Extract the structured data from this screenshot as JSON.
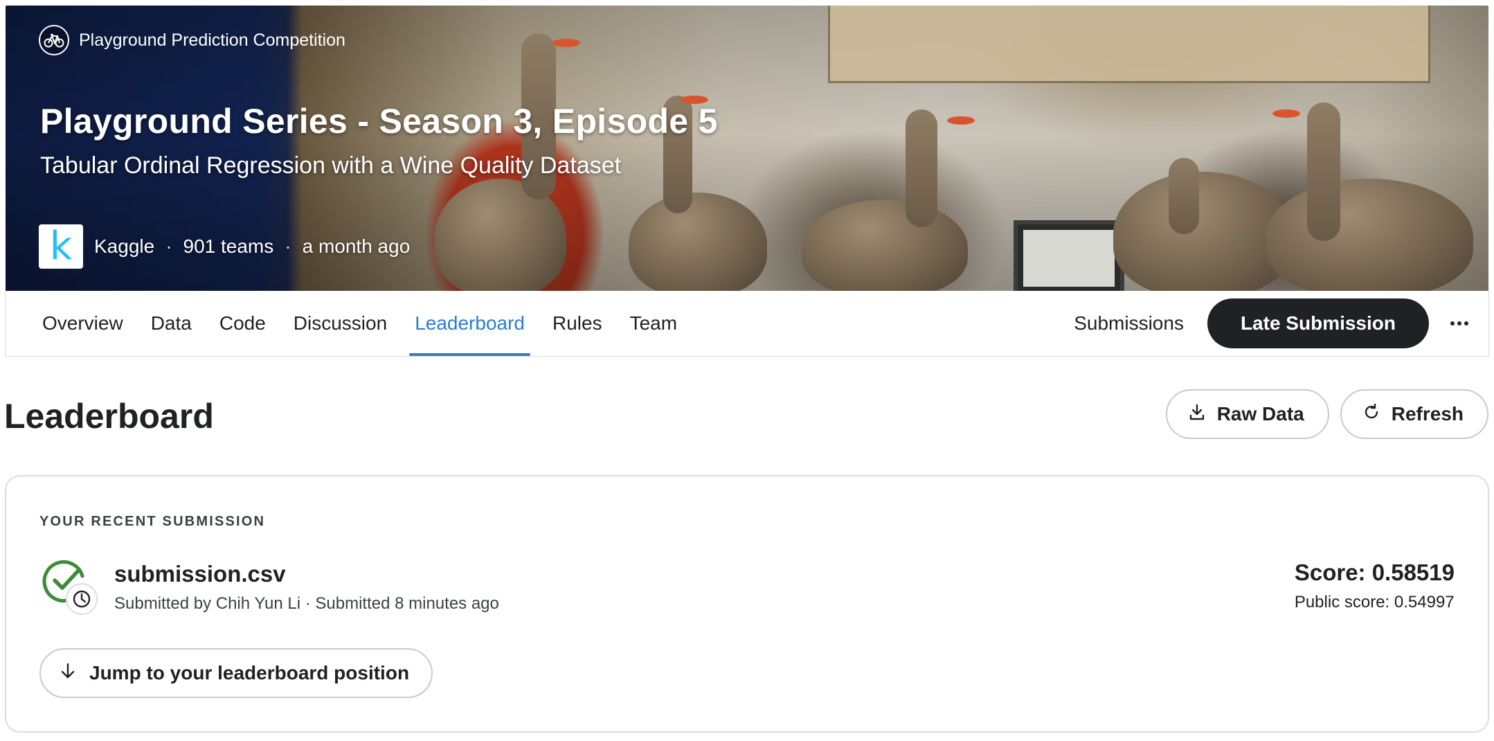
{
  "hero": {
    "competition_type": "Playground Prediction Competition",
    "title": "Playground Series - Season 3, Episode 5",
    "subtitle": "Tabular Ordinal Regression with a Wine Quality Dataset",
    "host_logo_letter": "k",
    "host": "Kaggle",
    "separator": "·",
    "teams": "901 teams",
    "time_ago": "a month ago",
    "competition_icon": "bicycle-icon"
  },
  "tabs": {
    "items": [
      {
        "label": "Overview",
        "active": false
      },
      {
        "label": "Data",
        "active": false
      },
      {
        "label": "Code",
        "active": false
      },
      {
        "label": "Discussion",
        "active": false
      },
      {
        "label": "Leaderboard",
        "active": true
      },
      {
        "label": "Rules",
        "active": false
      },
      {
        "label": "Team",
        "active": false
      }
    ],
    "submissions_label": "Submissions",
    "late_submission_label": "Late Submission",
    "more_icon": "more-horizontal-icon"
  },
  "page": {
    "title": "Leaderboard",
    "raw_data_label": "Raw Data",
    "refresh_label": "Refresh"
  },
  "recent_submission": {
    "section_label": "YOUR RECENT SUBMISSION",
    "file_name": "submission.csv",
    "meta": "Submitted by Chih Yun Li · Submitted 8 minutes ago",
    "score": "Score: 0.58519",
    "public_score": "Public score: 0.54997",
    "jump_label": "Jump to your leaderboard position",
    "status_icon": "check-circle-icon",
    "status_color": "#3d8b37"
  },
  "colors": {
    "accent_tab": "#2a7bd8",
    "dark_button": "#202124",
    "kaggle_blue": "#20beff"
  }
}
